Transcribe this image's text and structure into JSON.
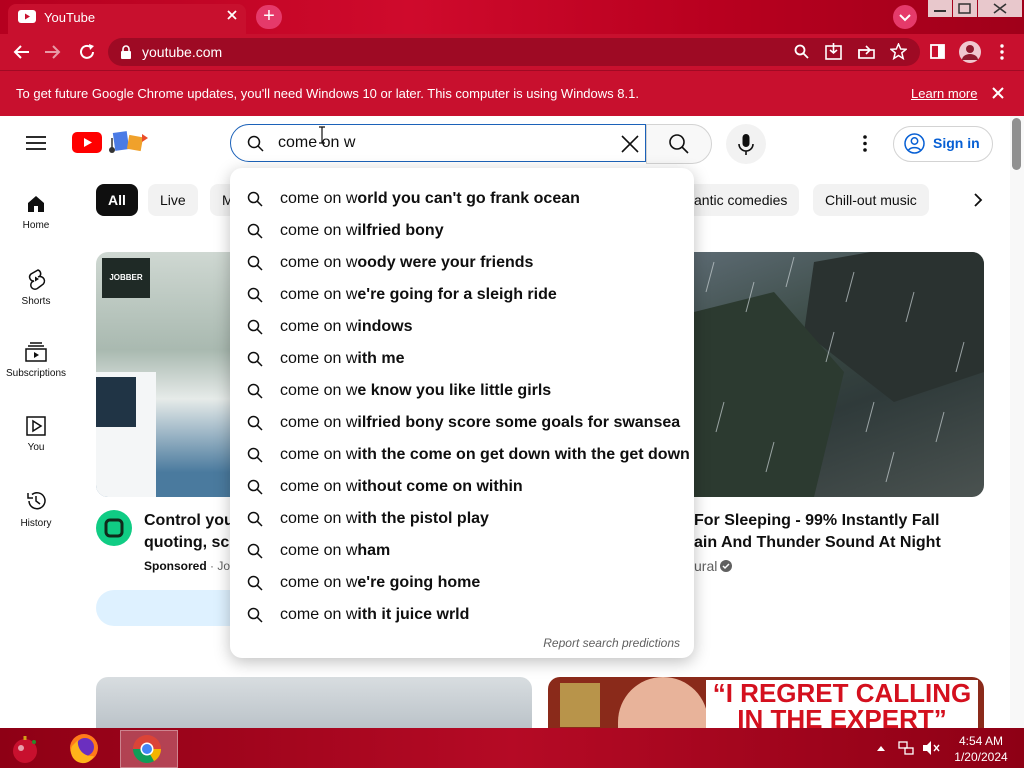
{
  "browser": {
    "tab_title": "YouTube",
    "url": "youtube.com",
    "info_bar": {
      "message": "To get future Google Chrome updates, you'll need Windows 10 or later. This computer is using Windows 8.1.",
      "learn_more": "Learn more"
    }
  },
  "youtube": {
    "search": {
      "value": "come on w",
      "suggestions": [
        {
          "prefix": "come on w",
          "rest": "orld you can't go frank ocean"
        },
        {
          "prefix": "come on w",
          "rest": "ilfried bony"
        },
        {
          "prefix": "come on w",
          "rest": "oody were your friends"
        },
        {
          "prefix": "come on w",
          "rest": "e're going for a sleigh ride"
        },
        {
          "prefix": "come on w",
          "rest": "indows"
        },
        {
          "prefix": "come on w",
          "rest": "ith me"
        },
        {
          "prefix": "come on w",
          "rest": "e know you like little girls"
        },
        {
          "prefix": "come on w",
          "rest": "ilfried bony score some goals for swansea"
        },
        {
          "prefix": "come on w",
          "rest": "ith the come on get down with the get down"
        },
        {
          "prefix": "come on w",
          "rest": "ithout come on within"
        },
        {
          "prefix": "come on w",
          "rest": "ith the pistol play"
        },
        {
          "prefix": "come on w",
          "rest": "ham"
        },
        {
          "prefix": "come on w",
          "rest": "e're going home"
        },
        {
          "prefix": "come on w",
          "rest": "ith it juice wrld"
        }
      ],
      "report_link": "Report search predictions"
    },
    "sign_in": "Sign in",
    "chips": [
      "All",
      "Live",
      "M",
      "antic comedies",
      "Chill-out music"
    ],
    "sidebar": [
      {
        "label": "Home",
        "icon": "home-icon"
      },
      {
        "label": "Shorts",
        "icon": "shorts-icon"
      },
      {
        "label": "Subscriptions",
        "icon": "subscriptions-icon"
      },
      {
        "label": "You",
        "icon": "you-icon"
      },
      {
        "label": "History",
        "icon": "history-icon"
      }
    ],
    "videos": [
      {
        "title_line1": "Control your",
        "title_line2": "quoting, sch",
        "meta": "Sponsored",
        "meta_suffix": "· Jo",
        "badge_text": "JOBBER"
      },
      {
        "title_line1": "For Sleeping - 99% Instantly Fall",
        "title_line2": "ain And Thunder Sound At Night",
        "meta": "ural"
      }
    ],
    "bottom_thumb_text": "“I REGRET CALLING IN THE EXPERT”"
  },
  "taskbar": {
    "time": "4:54 AM",
    "date": "1/20/2024"
  }
}
